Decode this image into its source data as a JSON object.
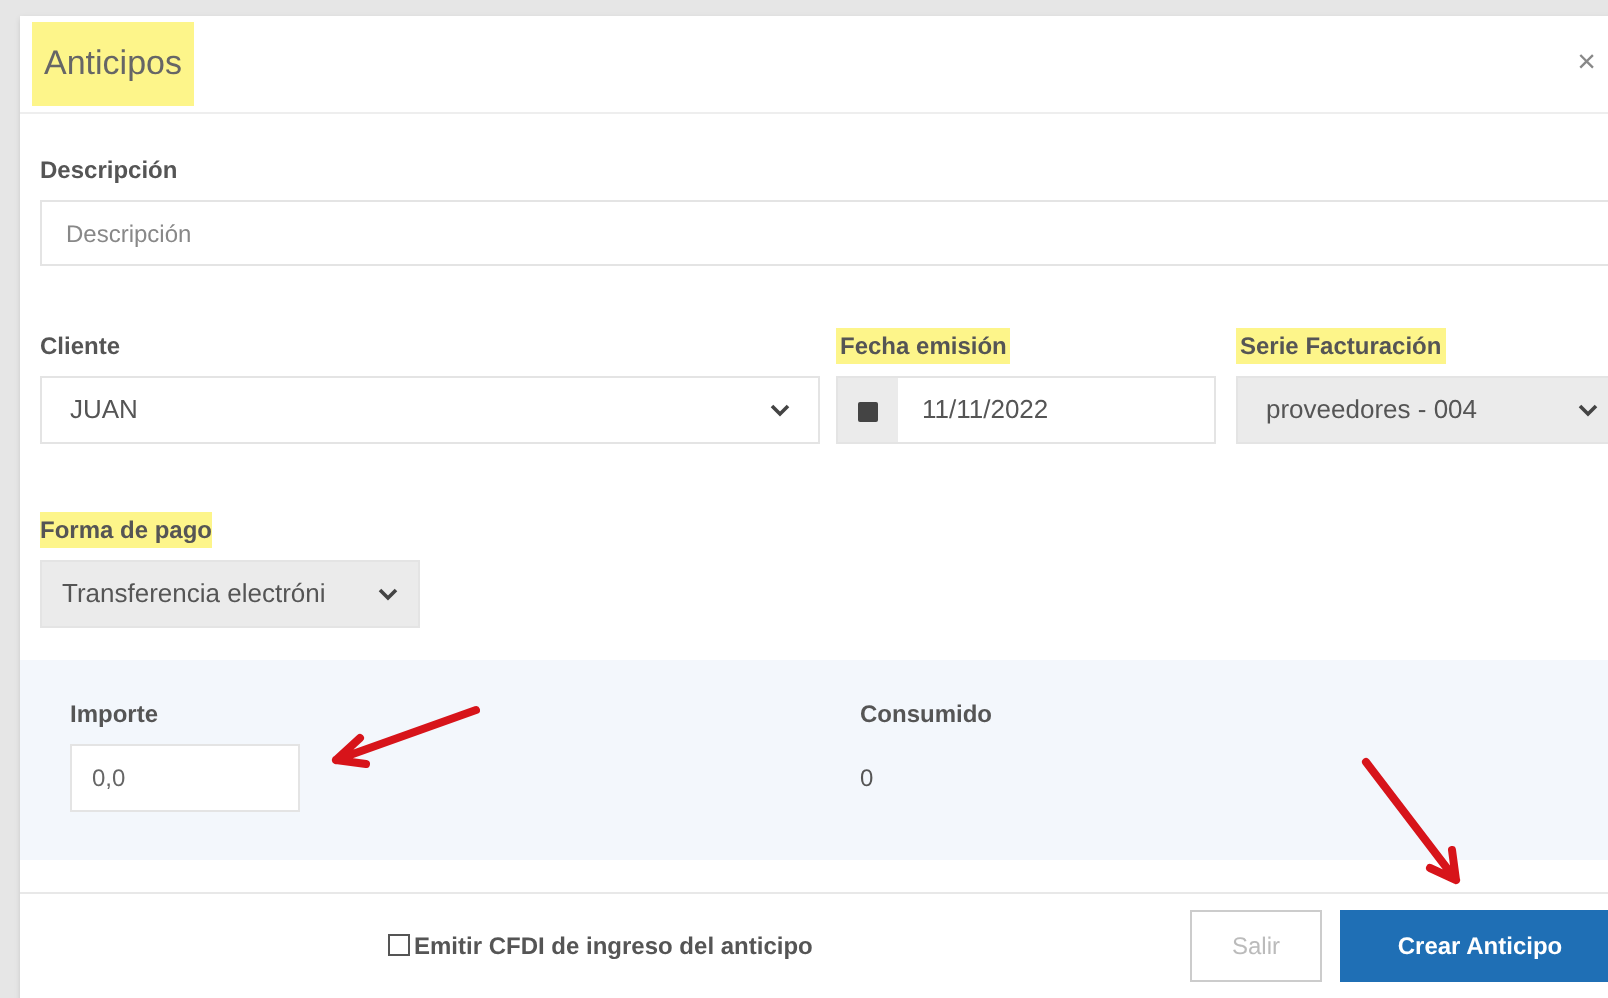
{
  "modal": {
    "title": {
      "text": "Anticipos",
      "highlighted": true
    },
    "close": "×"
  },
  "descripcion": {
    "label": {
      "text": "Descripción",
      "highlighted": false
    },
    "placeholder": "Descripción"
  },
  "cliente": {
    "label": {
      "text": "Cliente",
      "highlighted": false
    },
    "value": "JUAN"
  },
  "fecha": {
    "label": {
      "text": "Fecha emisión",
      "highlighted": true
    },
    "value": "11/11/2022"
  },
  "serie": {
    "label": {
      "text": "Serie Facturación",
      "highlighted": true
    },
    "value": "proveedores - 004",
    "disabled": true
  },
  "forma_pago": {
    "label": {
      "text": "Forma de pago",
      "highlighted": true
    },
    "value": "Transferencia electróni",
    "disabled": true
  },
  "importe": {
    "label": "Importe",
    "value": "0,0"
  },
  "consumido": {
    "label": "Consumido",
    "value": "0"
  },
  "emitir_cfdi": {
    "label": "Emitir CFDI de ingreso del anticipo",
    "checked": false
  },
  "buttons": [
    {
      "label": "Salir",
      "kind": "secondary",
      "disabled": true
    },
    {
      "label": "Crear Anticipo",
      "kind": "primary",
      "disabled": false
    }
  ]
}
